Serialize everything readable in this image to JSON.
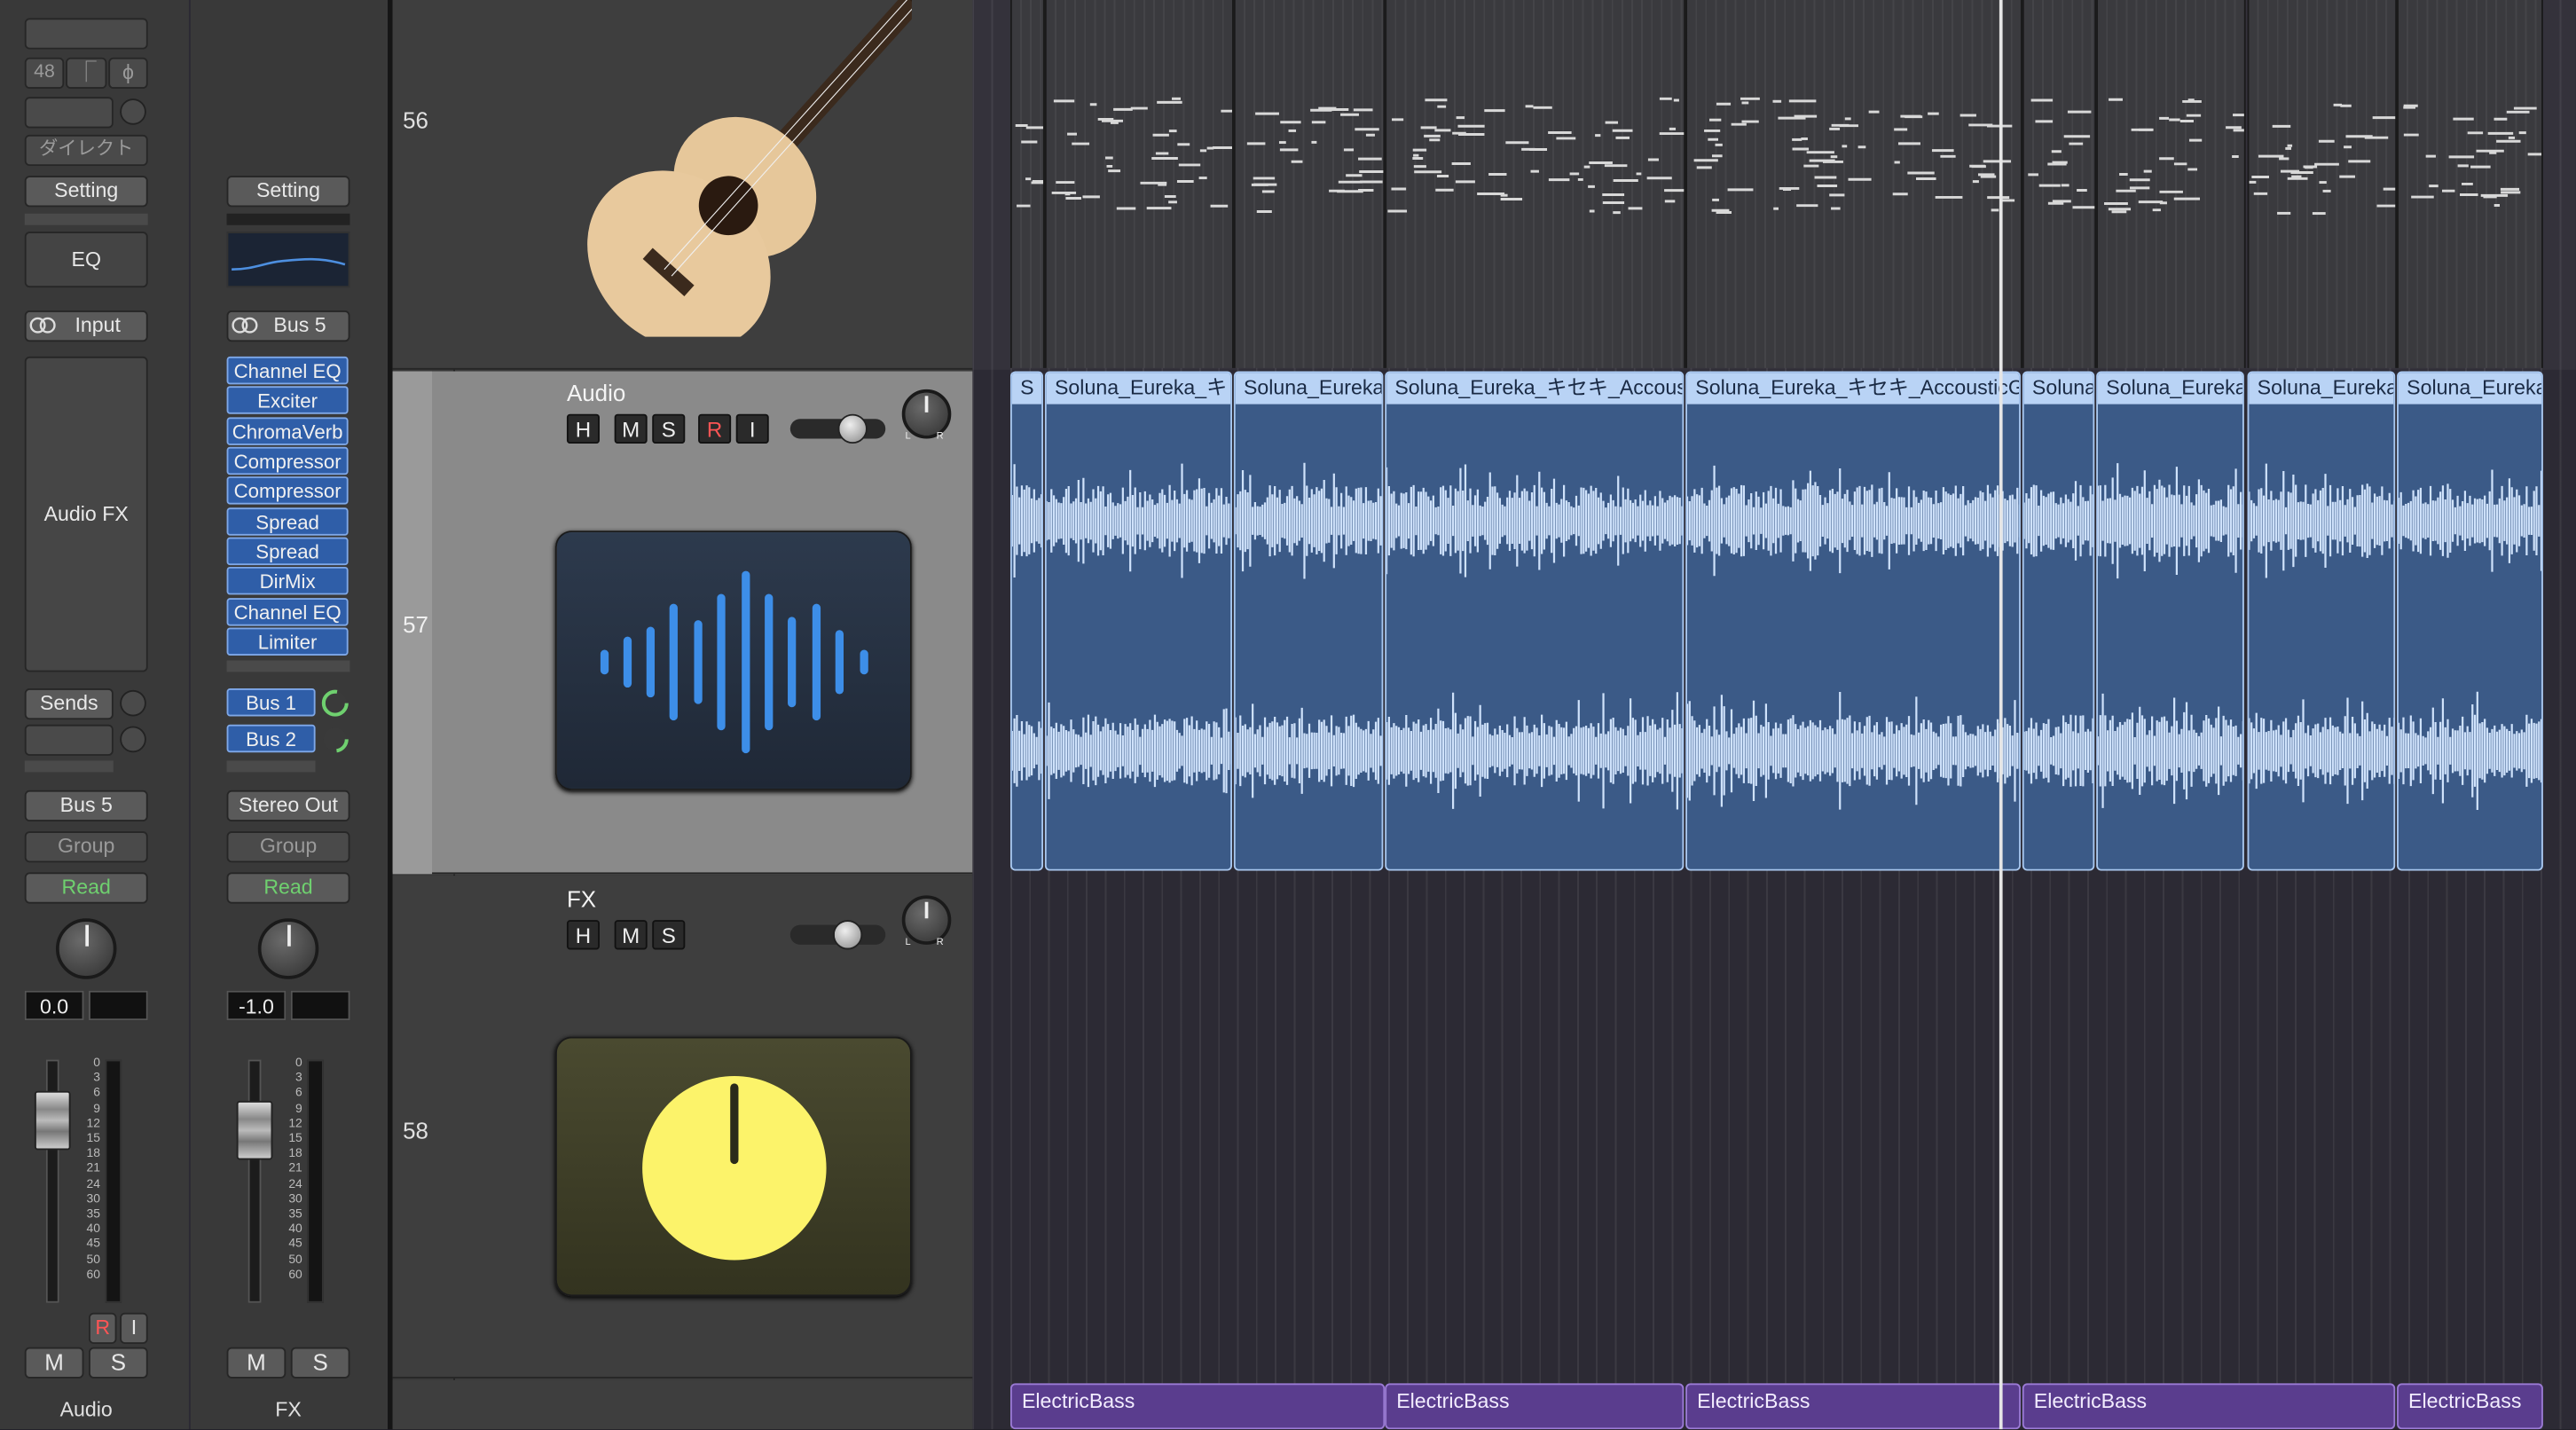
{
  "mixer": {
    "strip1": {
      "sample_rate": "48",
      "direct_label": "ダイレクト",
      "setting_label": "Setting",
      "eq_label": "EQ",
      "input_label": "Input",
      "audio_fx_label": "Audio FX",
      "sends_label": "Sends",
      "output_label": "Bus 5",
      "group_label": "Group",
      "automation_label": "Read",
      "volume_value": "0.0",
      "r_label": "R",
      "i_label": "I",
      "m_label": "M",
      "s_label": "S",
      "name": "Audio"
    },
    "strip2": {
      "setting_label": "Setting",
      "input_label": "Bus 5",
      "plugins": [
        "Channel EQ",
        "Exciter",
        "ChromaVerb",
        "Compressor",
        "Compressor",
        "Spread",
        "Spread",
        "DirMix",
        "Channel EQ",
        "Limiter"
      ],
      "sends": [
        "Bus 1",
        "Bus 2"
      ],
      "output_label": "Stereo Out",
      "group_label": "Group",
      "automation_label": "Read",
      "volume_value": "-1.0",
      "m_label": "M",
      "s_label": "S",
      "name": "FX"
    },
    "meter_scale": [
      "0",
      "3",
      "6",
      "9",
      "12",
      "15",
      "18",
      "21",
      "24",
      "30",
      "35",
      "40",
      "45",
      "50",
      "60"
    ]
  },
  "tracks": [
    {
      "number": "56",
      "name": "",
      "icon": "acoustic-guitar-icon"
    },
    {
      "number": "57",
      "name": "Audio",
      "icon": "waveform-icon",
      "buttons": [
        "H",
        "M",
        "S",
        "R",
        "I"
      ]
    },
    {
      "number": "58",
      "name": "FX",
      "icon": "fx-knob-icon",
      "buttons": [
        "H",
        "M",
        "S"
      ]
    }
  ],
  "pan_labels": {
    "left": "L",
    "right": "R"
  },
  "audio_regions": [
    "S",
    "Soluna_Eureka_キ",
    "Soluna_Eureka",
    "Soluna_Eureka_キセキ_Accousti",
    "Soluna_Eureka_キセキ_AccousticGu",
    "Soluna",
    "Soluna_Eureka",
    "Soluna_Eureka",
    "Soluna_Eureka"
  ],
  "bass_regions": [
    "ElectricBass",
    "ElectricBass",
    "ElectricBass",
    "ElectricBass",
    "ElectricBass"
  ],
  "colors": {
    "audio_region": "#3b5a87",
    "audio_header": "#b9d3f5",
    "bass_region": "#5a3d8e",
    "plugin_slot": "#2f5ea8",
    "read_green": "#6fd06f",
    "record_red": "#ff5555"
  }
}
